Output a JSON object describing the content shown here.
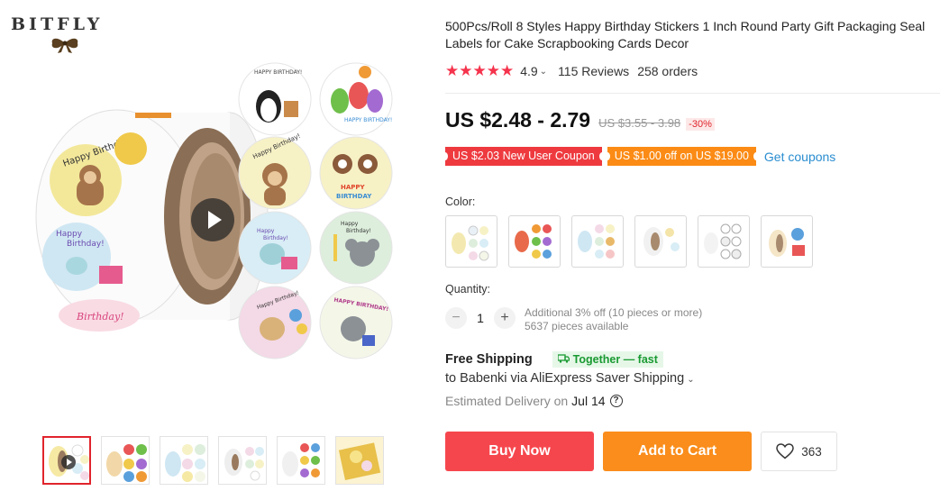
{
  "brand": {
    "name": "BITFLY"
  },
  "product": {
    "title": "500Pcs/Roll 8 Styles Happy Birthday Stickers 1 Inch Round Party Gift Packaging Seal Labels for Cake Scrapbooking Cards Decor",
    "rating": {
      "stars": "★★★★★",
      "score": "4.9",
      "reviews": "115 Reviews",
      "orders": "258 orders"
    },
    "price": {
      "current": "US $2.48 - 2.79",
      "original": "US $3.55 - 3.98",
      "discount": "-30%"
    },
    "coupons": [
      {
        "label": "US $2.03 New User Coupon",
        "color": "#ee3a3f"
      },
      {
        "label": "US $1.00 off on US $19.00",
        "color": "#fb8b15"
      }
    ],
    "get_coupons": "Get coupons"
  },
  "sticker_texts": {
    "happy_birthday_caps": "HAPPY BIRTHDAY!",
    "happy_birthday": "Happy Birthday!",
    "happy": "HAPPY",
    "birthday": "BIRTHDAY",
    "happy_lower": "Happy",
    "birthday_lower": "Birthday!",
    "birthday_script": "Birthday!"
  },
  "color": {
    "label": "Color:",
    "options_count": 6
  },
  "quantity": {
    "label": "Quantity:",
    "value": "1",
    "minus": "−",
    "plus": "+",
    "additional": "Additional 3% off (10 pieces or more)",
    "available": "5637 pieces available"
  },
  "shipping": {
    "title": "Free Shipping",
    "badge": "Together — fast",
    "to": "to Babenki via AliExpress Saver Shipping",
    "estimated_label": "Estimated Delivery on",
    "estimated_date": "Jul 14",
    "help": "?"
  },
  "actions": {
    "buy_now": "Buy Now",
    "add_to_cart": "Add to Cart",
    "wishlist_count": "363"
  },
  "colors": {
    "accent_red": "#f6464d",
    "accent_orange": "#fa8d1b",
    "star": "#f5334c",
    "link": "#2a8dd0",
    "green": "#1a9a32"
  },
  "icons": {
    "play": "play-icon",
    "heart": "heart-icon",
    "help": "help-icon",
    "truck": "truck-icon",
    "chevron": "chevron-down-icon"
  }
}
